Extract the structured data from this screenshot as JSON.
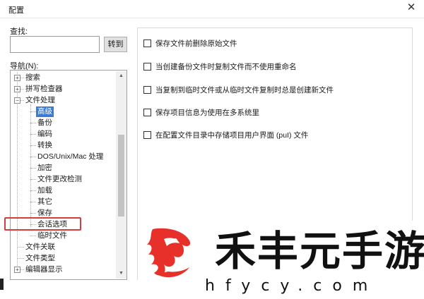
{
  "window": {
    "title": "配置"
  },
  "search": {
    "label": "查找:",
    "value": "",
    "placeholder": "",
    "goto_label": "转到"
  },
  "nav": {
    "label": "导航(N):",
    "items": [
      {
        "label": "搜索"
      },
      {
        "label": "拼写检查器"
      },
      {
        "label": "文件处理"
      },
      {
        "label": "高级"
      },
      {
        "label": "备份"
      },
      {
        "label": "编码"
      },
      {
        "label": "转换"
      },
      {
        "label": "DOS/Unix/Mac 处理"
      },
      {
        "label": "加密"
      },
      {
        "label": "文件更改检测"
      },
      {
        "label": "加载"
      },
      {
        "label": "其它"
      },
      {
        "label": "保存"
      },
      {
        "label": "会话选项"
      },
      {
        "label": "临时文件"
      },
      {
        "label": "文件关联"
      },
      {
        "label": "文件类型"
      },
      {
        "label": "编辑器显示"
      }
    ]
  },
  "options": [
    {
      "label": "保存文件前删除原始文件",
      "checked": false
    },
    {
      "label": "当创建备份文件时复制文件而不使用重命名",
      "checked": false
    },
    {
      "label": "当复制到临时文件或从临时文件复制时总是创建新文件",
      "checked": false
    },
    {
      "label": "保存项目信息为使用在多系统里",
      "checked": false
    },
    {
      "label": "在配置文件目录中存储项目用户界面 (puI) 文件",
      "checked": false
    }
  ],
  "watermark": {
    "text": "禾丰元手游",
    "subtext": "hfycy.com"
  },
  "colors": {
    "selection": "#3a7bd5",
    "highlight_box": "#cf3f3f",
    "logo_red": "#e8302a"
  }
}
